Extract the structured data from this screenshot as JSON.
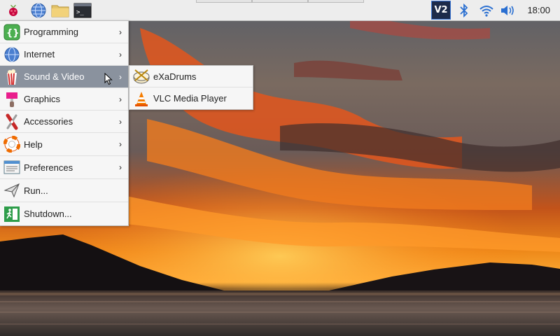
{
  "taskbar": {
    "launchers": [
      {
        "icon": "raspberry-pi-icon"
      },
      {
        "icon": "web-browser-icon"
      },
      {
        "icon": "file-manager-icon"
      },
      {
        "icon": "terminal-icon"
      }
    ],
    "tray": [
      {
        "icon": "vnc-icon",
        "label": "V2"
      },
      {
        "icon": "bluetooth-icon"
      },
      {
        "icon": "wifi-icon"
      },
      {
        "icon": "volume-icon"
      }
    ],
    "clock": "18:00"
  },
  "app_menu": {
    "items": [
      {
        "label": "Programming",
        "icon": "programming-icon",
        "submenu": true
      },
      {
        "label": "Internet",
        "icon": "internet-icon",
        "submenu": true
      },
      {
        "label": "Sound & Video",
        "icon": "sound-video-icon",
        "submenu": true,
        "active": true
      },
      {
        "label": "Graphics",
        "icon": "graphics-icon",
        "submenu": true
      },
      {
        "label": "Accessories",
        "icon": "accessories-icon",
        "submenu": true
      },
      {
        "label": "Help",
        "icon": "help-icon",
        "submenu": true
      },
      {
        "label": "Preferences",
        "icon": "preferences-icon",
        "submenu": true
      },
      {
        "label": "Run...",
        "icon": "run-icon",
        "submenu": false
      },
      {
        "label": "Shutdown...",
        "icon": "shutdown-icon",
        "submenu": false
      }
    ]
  },
  "sub_menu": {
    "items": [
      {
        "label": "eXaDrums",
        "icon": "exadrums-icon"
      },
      {
        "label": "VLC Media Player",
        "icon": "vlc-icon"
      }
    ]
  },
  "arrow_glyph": "›",
  "colors": {
    "panel": "#ededed",
    "menu_bg": "#f6f6f6",
    "menu_highlight": "#8a929e"
  }
}
